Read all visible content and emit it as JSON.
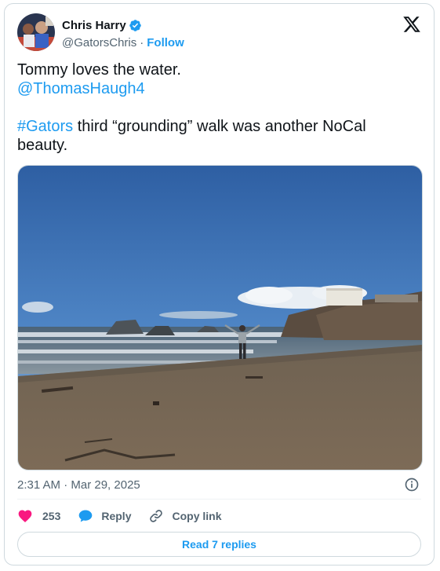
{
  "author": {
    "name": "Chris Harry",
    "handle": "@GatorsChris",
    "separator": "·",
    "follow_label": "Follow"
  },
  "tweet": {
    "line1": "Tommy loves the water.",
    "mention": "@ThomasHaugh4",
    "hashtag": "#Gators",
    "line3_rest": " third “grounding” walk was another NoCal beauty."
  },
  "timestamp": "2:31 AM · Mar 29, 2025",
  "actions": {
    "likes": "253",
    "reply_label": "Reply",
    "copy_label": "Copy link"
  },
  "read_replies_label": "Read 7 replies",
  "icons": {
    "verified": "verified-badge-icon",
    "logo": "x-logo-icon",
    "info": "info-icon",
    "like": "heart-icon",
    "reply": "speech-bubble-icon",
    "copy": "link-icon"
  },
  "colors": {
    "accent": "#1d9bf0",
    "like": "#f91880",
    "secondary_text": "#536471",
    "border": "#cfd9de"
  }
}
